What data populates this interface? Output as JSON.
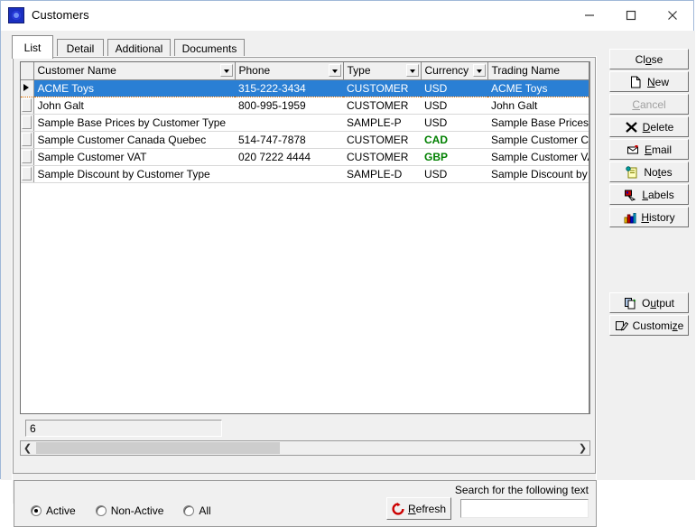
{
  "window": {
    "title": "Customers",
    "icon": "app-icon",
    "controls": {
      "minimize": "minimize-icon",
      "maximize": "maximize-icon",
      "close": "close-icon"
    }
  },
  "tabs": [
    {
      "label": "List",
      "active": true
    },
    {
      "label": "Detail",
      "active": false
    },
    {
      "label": "Additional",
      "active": false
    },
    {
      "label": "Documents",
      "active": false
    }
  ],
  "grid": {
    "columns": [
      {
        "label": "Customer Name",
        "dropdown": true
      },
      {
        "label": "Phone",
        "dropdown": true
      },
      {
        "label": "Type",
        "dropdown": true
      },
      {
        "label": "Currency",
        "dropdown": true
      },
      {
        "label": "Trading Name",
        "dropdown": false
      }
    ],
    "rows": [
      {
        "selected": true,
        "customer_name": "ACME Toys",
        "phone": "315-222-3434",
        "type": "CUSTOMER",
        "currency": "USD",
        "currency_color": "#000000",
        "trading_name": "ACME Toys"
      },
      {
        "selected": false,
        "customer_name": "John Galt",
        "phone": "800-995-1959",
        "type": "CUSTOMER",
        "currency": "USD",
        "currency_color": "#000000",
        "trading_name": "John Galt"
      },
      {
        "selected": false,
        "customer_name": "Sample Base Prices by Customer Type",
        "phone": "",
        "type": "SAMPLE-P",
        "currency": "USD",
        "currency_color": "#000000",
        "trading_name": "Sample Base Prices by Customer Type"
      },
      {
        "selected": false,
        "customer_name": "Sample Customer Canada Quebec",
        "phone": "514-747-7878",
        "type": "CUSTOMER",
        "currency": "CAD",
        "currency_color": "#008000",
        "trading_name": "Sample Customer Canada Quebec"
      },
      {
        "selected": false,
        "customer_name": "Sample Customer VAT",
        "phone": "020 7222 4444",
        "type": "CUSTOMER",
        "currency": "GBP",
        "currency_color": "#008000",
        "trading_name": "Sample Customer VAT"
      },
      {
        "selected": false,
        "customer_name": "Sample Discount by Customer Type",
        "phone": "",
        "type": "SAMPLE-D",
        "currency": "USD",
        "currency_color": "#000000",
        "trading_name": "Sample Discount by Customer Type"
      }
    ]
  },
  "record_count": "6",
  "scrollbar": {
    "left_arrow": "chevron-left-icon",
    "right_arrow": "chevron-right-icon"
  },
  "filters": {
    "options": [
      {
        "label": "Active",
        "selected": true
      },
      {
        "label": "Non-Active",
        "selected": false
      },
      {
        "label": "All",
        "selected": false
      }
    ]
  },
  "search": {
    "label": "Search for the following text",
    "value": "",
    "placeholder": ""
  },
  "refresh": {
    "label": "Refresh",
    "icon": "refresh-icon",
    "accel": "R"
  },
  "side_buttons": [
    {
      "label": "Close",
      "icon": null,
      "disabled": false,
      "accel": "o"
    },
    {
      "label": "New",
      "icon": "new-document-icon",
      "disabled": false,
      "accel": "N"
    },
    {
      "label": "Cancel",
      "icon": null,
      "disabled": true,
      "accel": "C"
    },
    {
      "label": "Delete",
      "icon": "delete-x-icon",
      "disabled": false,
      "accel": "D"
    },
    {
      "label": "Email",
      "icon": "email-icon",
      "disabled": false,
      "accel": "E"
    },
    {
      "label": "Notes",
      "icon": "notes-icon",
      "disabled": false,
      "accel": "t"
    },
    {
      "label": "Labels",
      "icon": "labels-icon",
      "disabled": false,
      "accel": "L"
    },
    {
      "label": "History",
      "icon": "history-chart-icon",
      "disabled": false,
      "accel": "H"
    }
  ],
  "side_buttons_lower": [
    {
      "label": "Output",
      "icon": "output-icon",
      "disabled": false,
      "accel": "u"
    },
    {
      "label": "Customize",
      "icon": "customize-icon",
      "disabled": false,
      "accel": "z"
    }
  ],
  "colors": {
    "selection_blue": "#2a7fd4",
    "face": "#f0f0f0",
    "currency_highlight": "#008000",
    "window_border": "#a0b8d8"
  }
}
